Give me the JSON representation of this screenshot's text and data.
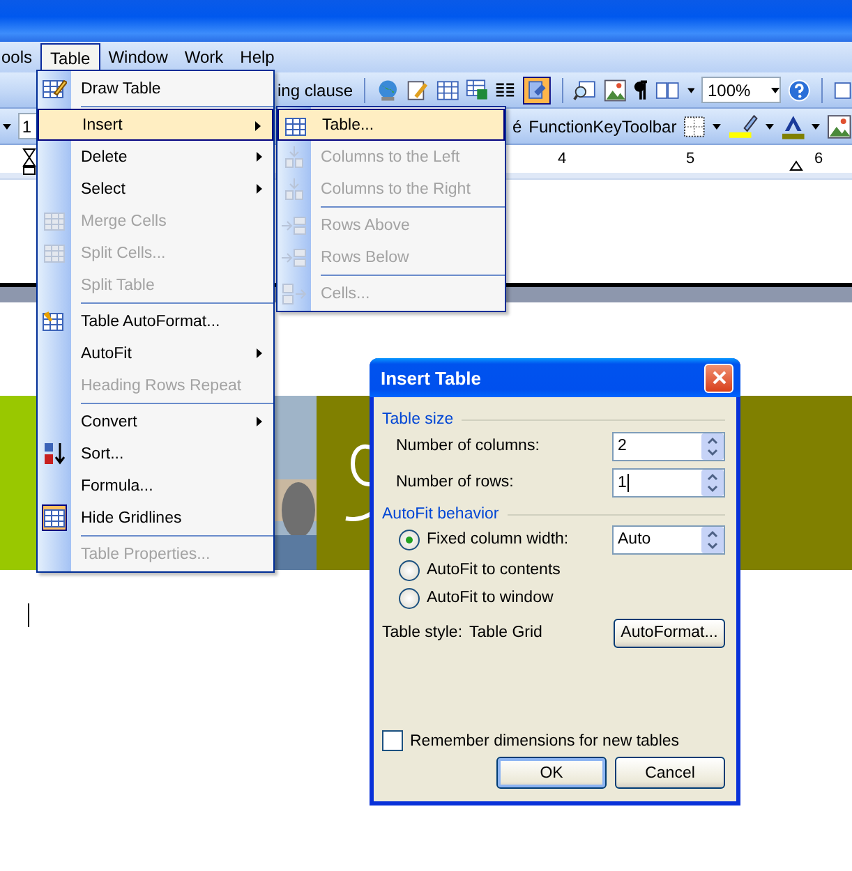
{
  "menu_bar": [
    {
      "label": "ools",
      "selected": false
    },
    {
      "label": "Table",
      "selected": true
    },
    {
      "label": "Window",
      "selected": false
    },
    {
      "label": "Work",
      "selected": false
    },
    {
      "label": "Help",
      "selected": false
    }
  ],
  "toolbar_1": {
    "text": "ing clause",
    "zoom": "100%"
  },
  "toolbar_2": {
    "font_size": "1",
    "style_fragment": "é",
    "toolbar_name": "FunctionKeyToolbar"
  },
  "ruler": {
    "numbers": [
      "4",
      "5",
      "6"
    ]
  },
  "table_menu": {
    "items": [
      {
        "kind": "item",
        "label": "Draw Table",
        "selected": false,
        "disabled": false,
        "submenu": false,
        "checked": false
      },
      {
        "kind": "separator"
      },
      {
        "kind": "item",
        "label": "Insert",
        "selected": true,
        "disabled": false,
        "submenu": true,
        "checked": false
      },
      {
        "kind": "item",
        "label": "Delete",
        "selected": false,
        "disabled": false,
        "submenu": true,
        "checked": false
      },
      {
        "kind": "item",
        "label": "Select",
        "selected": false,
        "disabled": false,
        "submenu": true,
        "checked": false
      },
      {
        "kind": "item",
        "label": "Merge Cells",
        "selected": false,
        "disabled": true,
        "submenu": false,
        "checked": false
      },
      {
        "kind": "item",
        "label": "Split Cells...",
        "selected": false,
        "disabled": true,
        "submenu": false,
        "checked": false
      },
      {
        "kind": "item",
        "label": "Split Table",
        "selected": false,
        "disabled": true,
        "submenu": false,
        "checked": false
      },
      {
        "kind": "separator"
      },
      {
        "kind": "item",
        "label": "Table AutoFormat...",
        "selected": false,
        "disabled": false,
        "submenu": false,
        "checked": false
      },
      {
        "kind": "item",
        "label": "AutoFit",
        "selected": false,
        "disabled": false,
        "submenu": true,
        "checked": false
      },
      {
        "kind": "item",
        "label": "Heading Rows Repeat",
        "selected": false,
        "disabled": true,
        "submenu": false,
        "checked": false
      },
      {
        "kind": "separator"
      },
      {
        "kind": "item",
        "label": "Convert",
        "selected": false,
        "disabled": false,
        "submenu": true,
        "checked": false
      },
      {
        "kind": "item",
        "label": "Sort...",
        "selected": false,
        "disabled": false,
        "submenu": false,
        "checked": false
      },
      {
        "kind": "item",
        "label": "Formula...",
        "selected": false,
        "disabled": false,
        "submenu": false,
        "checked": false
      },
      {
        "kind": "item",
        "label": "Hide Gridlines",
        "selected": false,
        "disabled": false,
        "submenu": false,
        "checked": true
      },
      {
        "kind": "separator"
      },
      {
        "kind": "item",
        "label": "Table Properties...",
        "selected": false,
        "disabled": true,
        "submenu": false,
        "checked": false
      }
    ]
  },
  "insert_submenu": {
    "items": [
      {
        "kind": "item",
        "label": "Table...",
        "selected": true,
        "disabled": false
      },
      {
        "kind": "item",
        "label": "Columns to the Left",
        "selected": false,
        "disabled": true
      },
      {
        "kind": "item",
        "label": "Columns to the Right",
        "selected": false,
        "disabled": true
      },
      {
        "kind": "separator"
      },
      {
        "kind": "item",
        "label": "Rows Above",
        "selected": false,
        "disabled": true
      },
      {
        "kind": "item",
        "label": "Rows Below",
        "selected": false,
        "disabled": true
      },
      {
        "kind": "separator"
      },
      {
        "kind": "item",
        "label": "Cells...",
        "selected": false,
        "disabled": true
      }
    ]
  },
  "dialog": {
    "title": "Insert Table",
    "table_size": {
      "heading": "Table size",
      "columns_label": "Number of columns:",
      "columns_value": "2",
      "rows_label": "Number of rows:",
      "rows_value": "1"
    },
    "autofit": {
      "heading": "AutoFit behavior",
      "width_value": "Auto",
      "options": [
        {
          "label": "Fixed column width:",
          "selected": true
        },
        {
          "label": "AutoFit to contents",
          "selected": false
        },
        {
          "label": "AutoFit to window",
          "selected": false
        }
      ]
    },
    "table_style_label": "Table style:",
    "table_style": "Table Grid",
    "autoformat_button": "AutoFormat...",
    "remember": {
      "label": "Remember dimensions for new tables",
      "checked": false
    },
    "buttons": [
      {
        "label": "OK",
        "default": true
      },
      {
        "label": "Cancel",
        "default": false
      }
    ]
  }
}
